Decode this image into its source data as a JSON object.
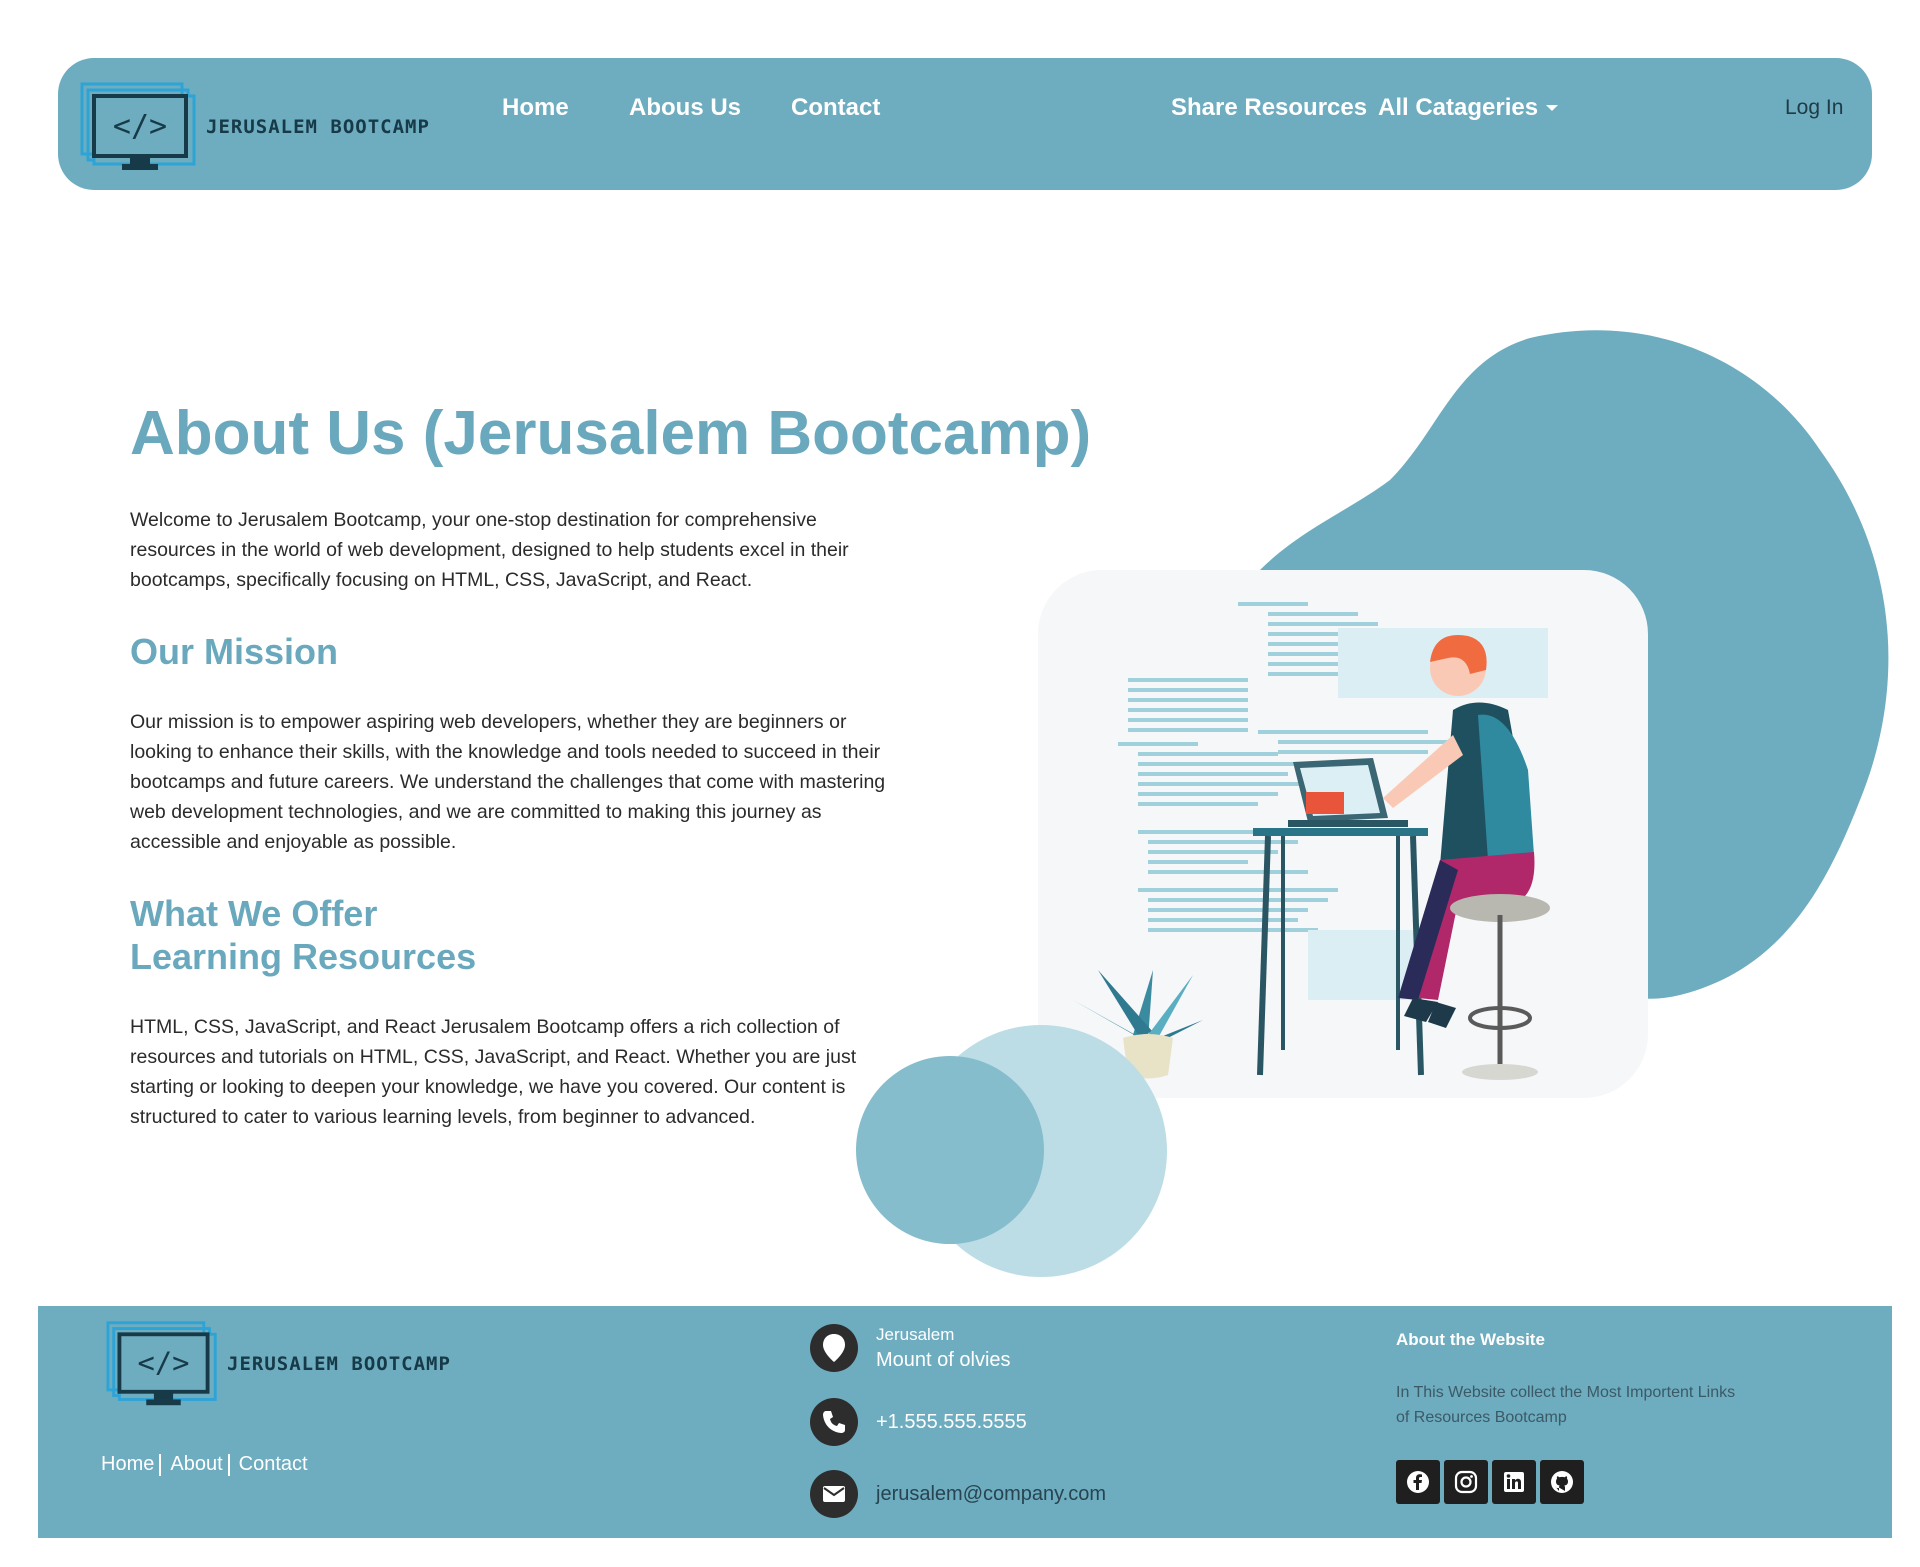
{
  "brand": {
    "name": "JERUSALEM BOOTCAMP",
    "logo_glyph": "</>"
  },
  "nav": {
    "home": "Home",
    "about": "Abous Us",
    "contact": "Contact",
    "share": "Share Resources",
    "categories": "All Catageries",
    "login": "Log In"
  },
  "main": {
    "title": "About Us (Jerusalem Bootcamp)",
    "intro": "Welcome to Jerusalem Bootcamp, your one-stop destination for comprehensive resources in the world of web development, designed to help students excel in their bootcamps, specifically focusing on HTML, CSS, JavaScript, and React.",
    "mission_heading": "Our Mission",
    "mission_text": "Our mission is to empower aspiring web developers, whether they are beginners or looking to enhance their skills, with the knowledge and tools needed to succeed in their bootcamps and future careers. We understand the challenges that come with mastering web development technologies, and we are committed to making this journey as accessible and enjoyable as possible.",
    "offer_heading": "What We Offer",
    "resources_heading": "Learning Resources",
    "resources_text": "HTML, CSS, JavaScript, and React Jerusalem Bootcamp offers a rich collection of resources and tutorials on HTML, CSS, JavaScript, and React. Whether you are just starting or looking to deepen your knowledge, we have you covered. Our content is structured to cater to various learning levels, from beginner to advanced."
  },
  "footer": {
    "links": {
      "home": "Home",
      "about": "About",
      "contact": "Contact"
    },
    "city": "Jerusalem",
    "address": "Mount of olvies",
    "phone": "+1.555.555.5555",
    "email": "jerusalem@company.com",
    "about_title": "About the Website",
    "about_text": "In This Website collect the Most Importent Links of Resources Bootcamp",
    "socials": [
      "facebook-icon",
      "instagram-icon",
      "linkedin-icon",
      "github-icon"
    ]
  },
  "colors": {
    "primary": "#6eacbf",
    "heading": "#6aa8bd",
    "dark": "#163a48"
  }
}
